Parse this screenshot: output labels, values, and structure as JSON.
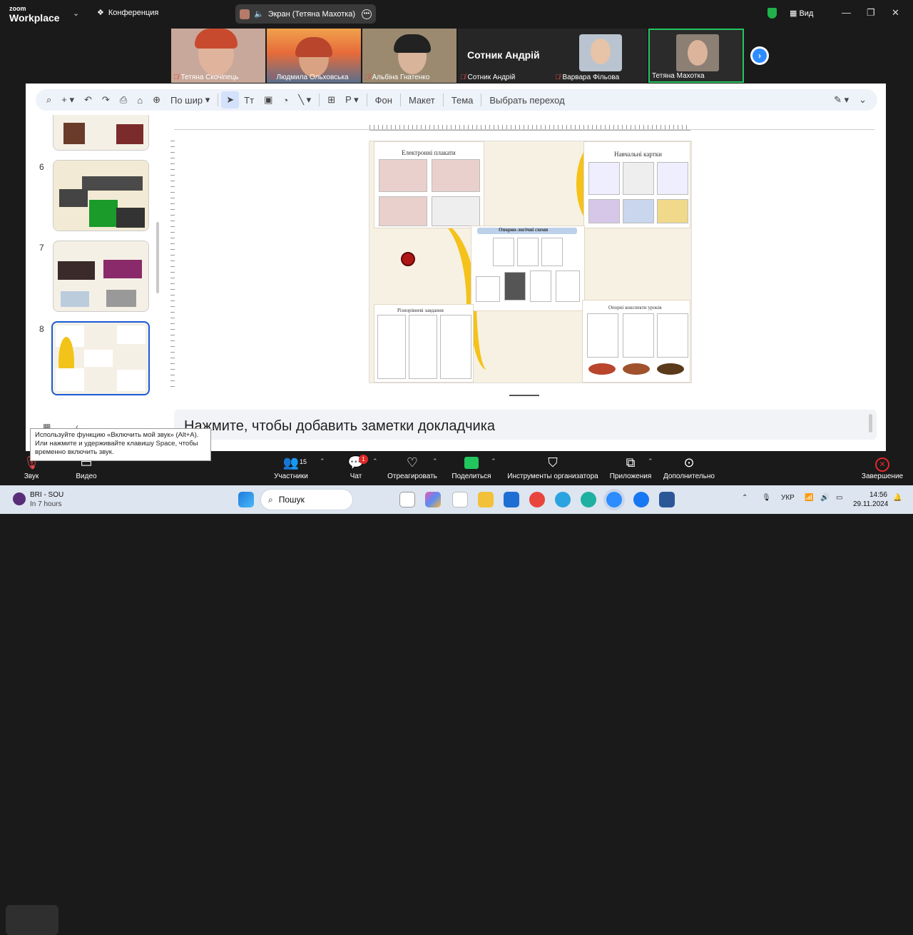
{
  "topbar": {
    "logo_top": "zoom",
    "logo_bottom": "Workplace",
    "conference": "Конференция",
    "screen_share": "Экран (Тетяна Махотка)",
    "view": "Вид"
  },
  "participants": [
    {
      "name": "Тетяна Скочіпець"
    },
    {
      "name": "Людмила Ольховська"
    },
    {
      "name": "Альбіна Гнатенко"
    },
    {
      "name": "Сотник Андрій",
      "big_name": "Сотник Андрій"
    },
    {
      "name": "Варвара Фільова"
    },
    {
      "name": "Тетяна Махотка"
    }
  ],
  "toolbar": {
    "zoom": "По шир",
    "background": "Фон",
    "layout": "Макет",
    "theme": "Тема",
    "transition": "Выбрать переход"
  },
  "thumbnails": {
    "numbers": [
      "6",
      "7",
      "8"
    ]
  },
  "slide": {
    "p1": "Електронні плакати",
    "p2": "Навчальні картки",
    "p3": "Опорно-логічні схеми",
    "p4": "Різнорівневі завдання",
    "p5": "Опорні конспекти уроків"
  },
  "notes": "Нажмите, чтобы добавить заметки докладчика",
  "tooltip": "Используйте функцию «Включить мой звук» (Alt+A). Или нажмите и удерживайте клавишу Space, чтобы временно включить звук.",
  "bottombar": {
    "sound": "Звук",
    "video": "Видео",
    "participants": "Участники",
    "participants_count": "15",
    "chat": "Чат",
    "chat_badge": "1",
    "react": "Отреагировать",
    "share": "Поделиться",
    "host_tools": "Инструменты организатора",
    "apps": "Приложения",
    "more": "Дополнительно",
    "end": "Завершение"
  },
  "taskbar": {
    "app_title": "BRI - SOU",
    "app_sub": "In 7 hours",
    "search": "Пошук",
    "lang": "УКР",
    "time": "14:56",
    "date": "29.11.2024"
  }
}
